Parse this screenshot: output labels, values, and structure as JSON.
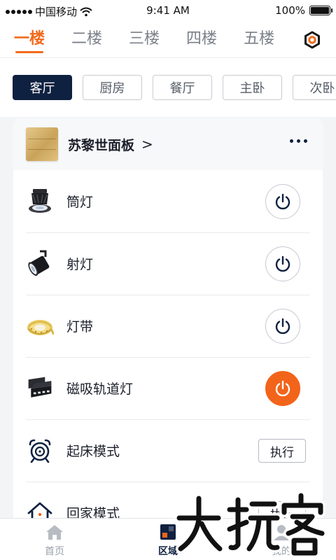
{
  "status_bar": {
    "carrier": "中国移动",
    "time": "9:41 AM",
    "battery": "100%"
  },
  "floors": {
    "active_index": 0,
    "items": [
      "一楼",
      "二楼",
      "三楼",
      "四楼",
      "五楼"
    ],
    "settings_icon": "hex-settings-icon",
    "accent_color": "#f26a1b"
  },
  "rooms": {
    "active_index": 0,
    "items": [
      "客厅",
      "厨房",
      "餐厅",
      "主卧",
      "次卧"
    ]
  },
  "panel": {
    "title": "苏黎世面板",
    "chevron": ">",
    "devices": [
      {
        "label": "筒灯",
        "icon": "downlight-icon",
        "power": "off"
      },
      {
        "label": "射灯",
        "icon": "spotlight-icon",
        "power": "off"
      },
      {
        "label": "灯带",
        "icon": "light-strip-icon",
        "power": "off"
      },
      {
        "label": "磁吸轨道灯",
        "icon": "track-light-icon",
        "power": "on"
      }
    ],
    "scenes": [
      {
        "label": "起床模式",
        "icon": "alarm-clock-icon",
        "action": "执行"
      },
      {
        "label": "回家模式",
        "icon": "home-icon",
        "action": "执行"
      }
    ]
  },
  "bottom_nav": {
    "active_index": 1,
    "items": [
      {
        "label": "首页",
        "icon": "home-icon"
      },
      {
        "label": "区域",
        "icon": "grid-icon"
      },
      {
        "label": "我的",
        "icon": "user-icon"
      }
    ]
  },
  "watermark": "大玩客"
}
